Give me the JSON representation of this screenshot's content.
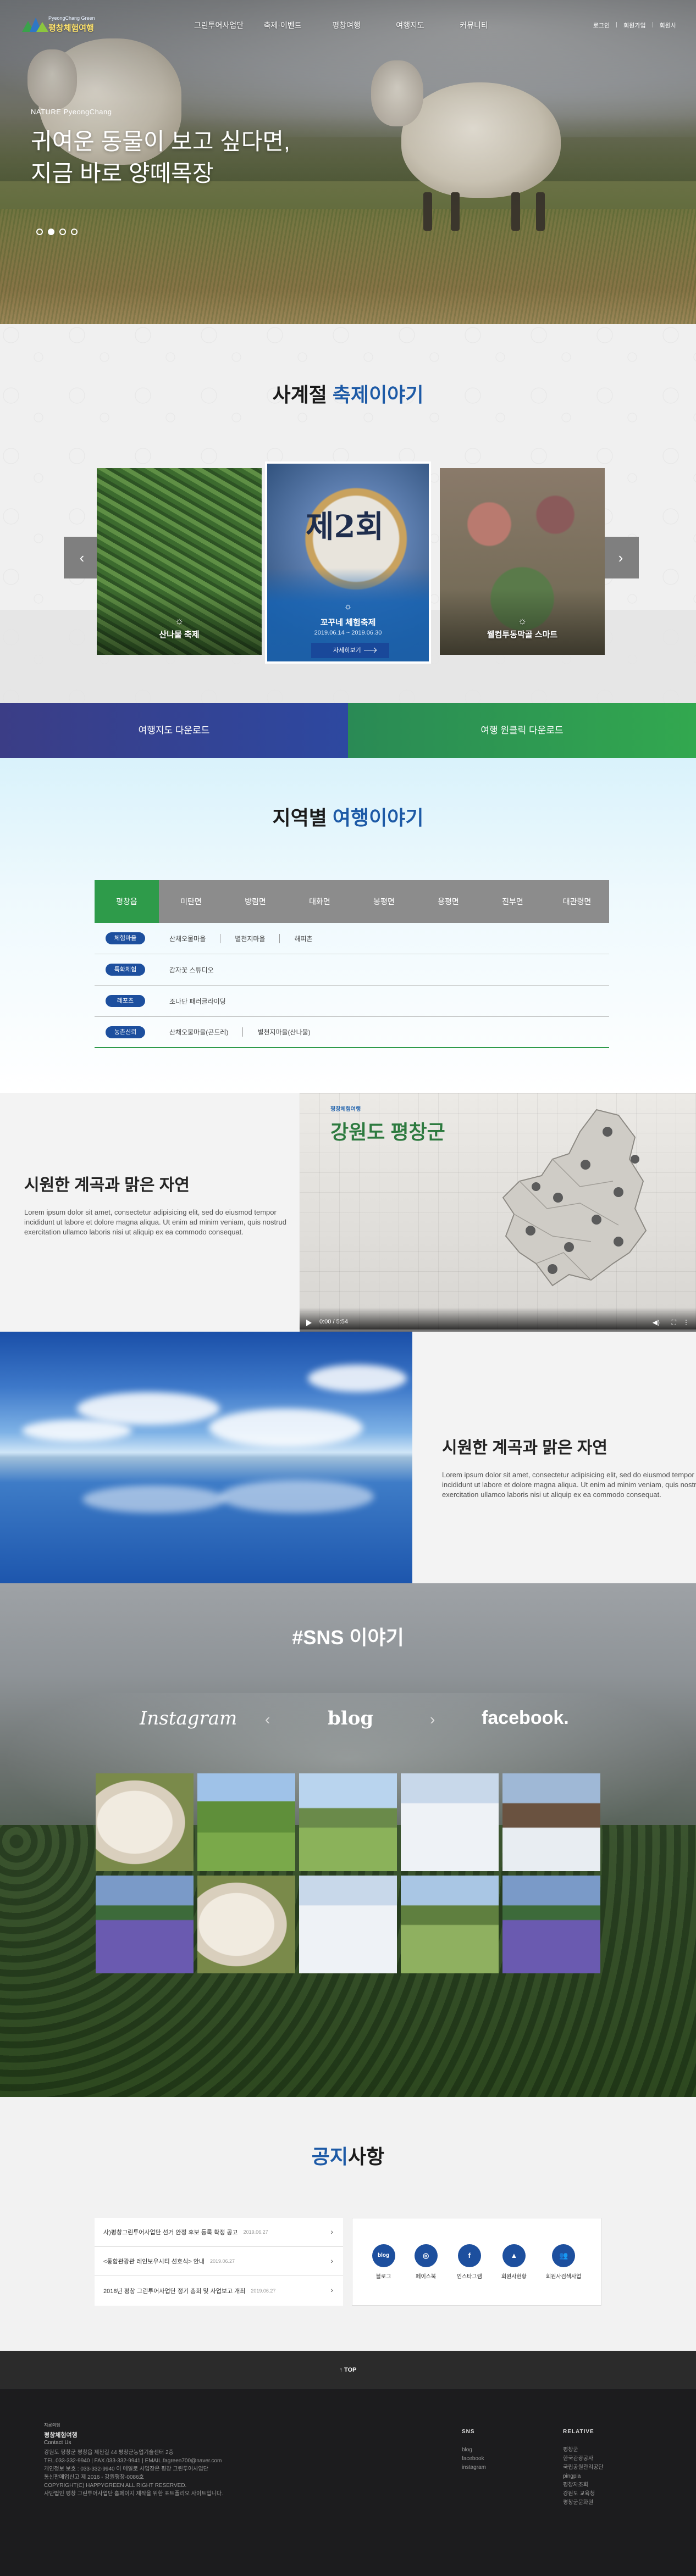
{
  "header": {
    "logo_sub": "PyeongChang Green",
    "logo_name": "평창체험여행",
    "menu": [
      "그린투어사업단",
      "축제·이벤트",
      "평창여행",
      "여행지도",
      "커뮤니티"
    ],
    "util": [
      "로그인",
      "회원가입",
      "회원사"
    ]
  },
  "hero": {
    "kicker": "NATURE PyeongChang",
    "line1": "귀여운 동물이 보고 싶다면,",
    "line2": "지금 바로 양떼목장",
    "slides": 4,
    "active_slide": 2
  },
  "festival": {
    "title_plain": "사계절 ",
    "title_hl": "축제이야기",
    "prev": "‹",
    "next": "›",
    "cards": [
      {
        "label": "산나물 축제"
      },
      {
        "title": "꼬꾸네 체험축제",
        "date": "2019.06.14 ~ 2019.06.30",
        "more": "자세히보기"
      },
      {
        "label": "웰컴투동막골 스마트"
      }
    ]
  },
  "downloads": {
    "map": "여행지도 다운로드",
    "app": "여행 원클릭 다운로드"
  },
  "region": {
    "title_plain": "지역별 ",
    "title_hl": "여행이야기",
    "tabs": [
      "평창읍",
      "미탄면",
      "방림면",
      "대화면",
      "봉평면",
      "용평면",
      "진부면",
      "대관령면"
    ],
    "active_tab": 0,
    "rows": [
      {
        "tag": "체험마을",
        "items": [
          "산채오물마을",
          "별천지마을",
          "해피촌"
        ]
      },
      {
        "tag": "특화체험",
        "items": [
          "감자꽃 스튜디오"
        ]
      },
      {
        "tag": "레포츠",
        "items": [
          "조나단 패러글라이딩"
        ]
      },
      {
        "tag": "농촌신뢰",
        "items": [
          "산채오물마을(곤드레)",
          "별천지마을(산나물)"
        ]
      }
    ]
  },
  "nature1": {
    "title": "시원한 계곡과 맑은 자연",
    "body": "Lorem ipsum dolor sit amet, consectetur adipisicing elit, sed do eiusmod tempor incididunt ut labore et dolore magna aliqua. Ut enim ad minim veniam, quis nostrud exercitation ullamco laboris nisi ut aliquip ex ea commodo consequat.",
    "video_brand": "평창체험여행",
    "video_title": "강원도 평창군",
    "video_time": "0:00 / 5:54"
  },
  "nature2": {
    "title": "시원한 계곡과 맑은 자연",
    "body": "Lorem ipsum dolor sit amet, consectetur adipisicing elit, sed do eiusmod tempor incididunt ut labore et dolore magna aliqua. Ut enim ad minim veniam, quis nostrud exercitation ullamco laboris nisi ut aliquip ex ea commodo consequat."
  },
  "sns": {
    "title": "#SNS 이야기",
    "brands": [
      "Instagram",
      "blog",
      "facebook."
    ],
    "prev": "‹",
    "next": "›",
    "photos": [
      "sheep",
      "field",
      "hill",
      "snow-crowd",
      "snow-village",
      "lavender",
      "sheep",
      "snow-crowd",
      "hill-sheep",
      "lavender"
    ]
  },
  "notice": {
    "title_hl": "공지",
    "title_plain": "사항",
    "items": [
      {
        "text": "사)평창그린투어사업단 선거 안정 후보 등록 확정 공고",
        "date": "2019.06.27"
      },
      {
        "text": "<통합관광관 레인보우시티 선호식> 안내",
        "date": "2019.06.27"
      },
      {
        "text": "2018년 평창 그린투어사업단 정기 총회 및 사업보고 개최",
        "date": "2019.06.27"
      }
    ],
    "quick": [
      {
        "label": "블로그",
        "icon": "blog"
      },
      {
        "label": "페이스북",
        "icon": "instagram-icon"
      },
      {
        "label": "인스타그램",
        "icon": "facebook-icon"
      },
      {
        "label": "회원사현황",
        "icon": "mountain-icon"
      },
      {
        "label": "회원사검색사업",
        "icon": "users-icon"
      }
    ]
  },
  "top_button": "↑ TOP",
  "footer": {
    "logo_sub": "지릉의딤",
    "logo_name": "평창체험여행",
    "contact_label": "Contact Us",
    "info": [
      "강원도 평창군 평창읍 제천길 44 평창군농업기술센터 2층",
      "TEL.033-332-9940 | FAX.033-332-9941 | EMAIL.fagreen700@naver.com",
      "개인정보 보호 : 033-332-9940 이 메일로 사업장은 평창 그린투어사업단",
      "통신판매업신고 제 2016 - 강원평창-0086호",
      "COPYRIGHT(C) HAPPYGREEN ALL RIGHT RESERVED.",
      "사단법인 평창 그린투어사업단 홈페이지 제작을 위한 포트폴리오 사이트입니다."
    ],
    "sns_title": "SNS",
    "sns_links": [
      "blog",
      "facebook",
      "instagram"
    ],
    "relative_title": "RELATIVE",
    "relative_links": [
      "평창군",
      "한국관광공사",
      "국립공원관리공단",
      "pingpia",
      "평창자조회",
      "강원도 교육청",
      "평창군문화원"
    ]
  }
}
